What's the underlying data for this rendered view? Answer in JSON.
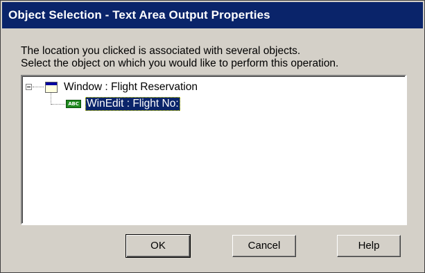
{
  "window": {
    "title": "Object Selection - Text Area Output Properties"
  },
  "message": {
    "line1": "The location you clicked is associated with several objects.",
    "line2": "Select the object on which you would like to perform this operation."
  },
  "tree": {
    "nodes": [
      {
        "label": "Window : Flight Reservation",
        "icon": "window-icon",
        "expanded": true
      },
      {
        "label": "WinEdit : Flight No:",
        "icon": "winedit-icon",
        "icon_text": "ABC",
        "selected": true
      }
    ]
  },
  "buttons": {
    "ok": "OK",
    "cancel": "Cancel",
    "help": "Help"
  },
  "colors": {
    "title_bar": "#0a246a",
    "dialog_face": "#d4d0c8",
    "selection": "#0a246a",
    "edit_icon": "#1f8a1f"
  }
}
